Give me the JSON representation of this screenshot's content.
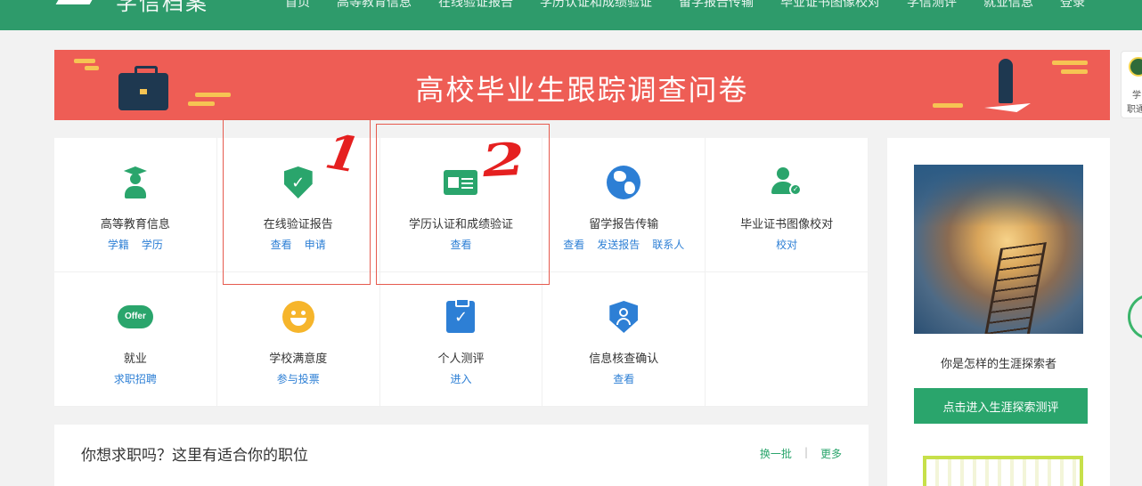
{
  "topbar": {
    "logo_text": "学信档案",
    "nav": [
      "首页",
      "高等教育信息",
      "在线验证报告",
      "学历认证和成绩验证",
      "留学报告传输",
      "毕业证书图像校对",
      "学信测评",
      "就业信息",
      "登录"
    ]
  },
  "banner": {
    "title": "高校毕业生跟踪调查问卷"
  },
  "side_widget": {
    "line1": "学",
    "line2": "职通"
  },
  "services": [
    {
      "name": "高等教育信息",
      "icon": "graduate-icon",
      "links": [
        "学籍",
        "学历"
      ]
    },
    {
      "name": "在线验证报告",
      "icon": "shield-check-icon",
      "links": [
        "查看",
        "申请"
      ]
    },
    {
      "name": "学历认证和成绩验证",
      "icon": "id-card-icon",
      "links": [
        "查看"
      ]
    },
    {
      "name": "留学报告传输",
      "icon": "globe-icon",
      "links": [
        "查看",
        "发送报告",
        "联系人"
      ]
    },
    {
      "name": "毕业证书图像校对",
      "icon": "user-check-icon",
      "links": [
        "校对"
      ]
    },
    {
      "name": "就业",
      "icon": "offer-icon",
      "icon_text": "Offer",
      "links": [
        "求职招聘"
      ]
    },
    {
      "name": "学校满意度",
      "icon": "smile-icon",
      "links": [
        "参与投票"
      ]
    },
    {
      "name": "个人测评",
      "icon": "clipboard-check-icon",
      "links": [
        "进入"
      ]
    },
    {
      "name": "信息核查确认",
      "icon": "user-verify-icon",
      "links": [
        "查看"
      ]
    }
  ],
  "annotations": {
    "num1": "1",
    "num2": "2"
  },
  "jobs": {
    "title": "你想求职吗？这里有适合你的职位",
    "refresh": "换一批",
    "separator": "|",
    "more": "更多"
  },
  "rightcol": {
    "caption": "你是怎样的生涯探索者",
    "button": "点击进入生涯探索测评"
  },
  "colors": {
    "green": "#2aa56c",
    "topbar": "#2e9b6b",
    "banner": "#ee5d55",
    "link_blue": "#2d7fd5",
    "annotation_red": "#e52020"
  }
}
